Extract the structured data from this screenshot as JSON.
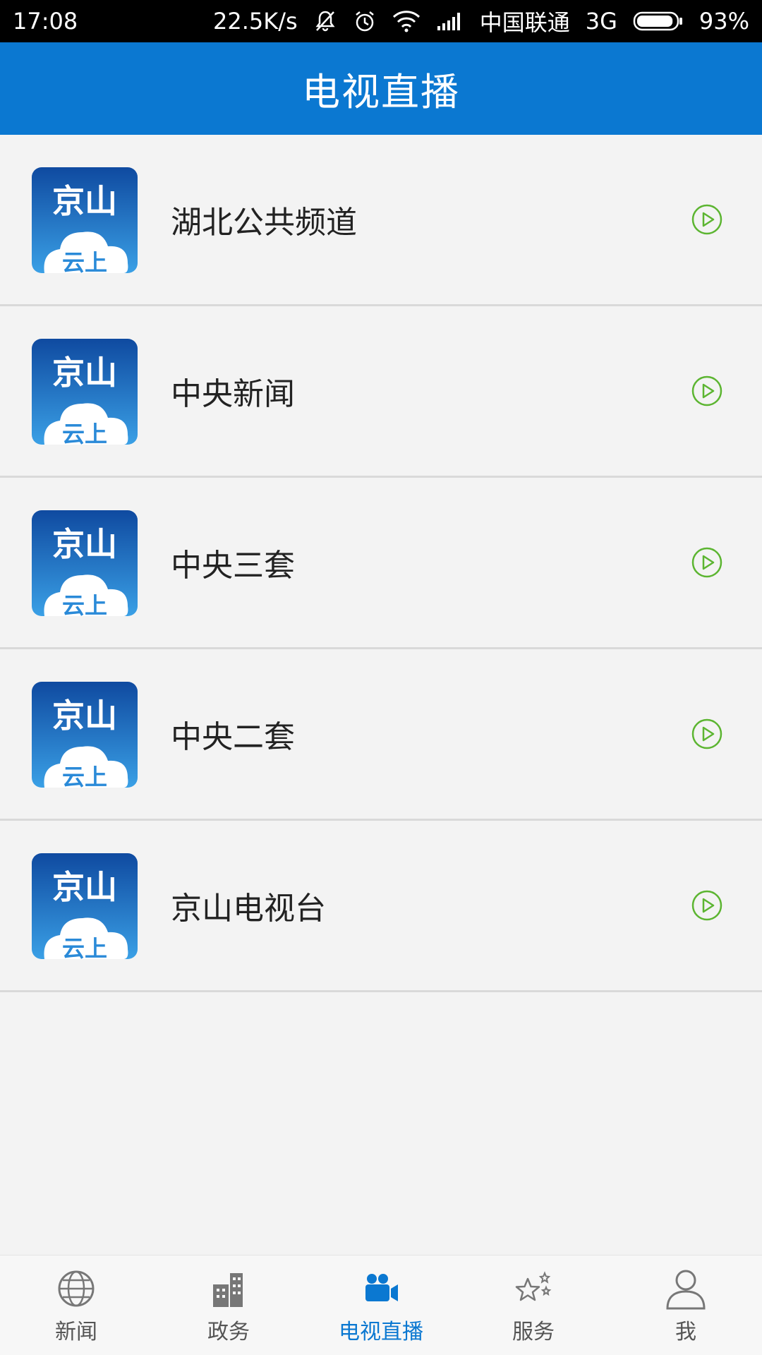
{
  "status": {
    "time": "17:08",
    "net_speed": "22.5K/s",
    "carrier": "中国联通",
    "network": "3G",
    "battery": "93%",
    "battery_level": 0.93
  },
  "header": {
    "title": "电视直播"
  },
  "channels": [
    {
      "name": "湖北公共频道",
      "logo_top": "京山",
      "logo_bottom": "云上"
    },
    {
      "name": "中央新闻",
      "logo_top": "京山",
      "logo_bottom": "云上"
    },
    {
      "name": "中央三套",
      "logo_top": "京山",
      "logo_bottom": "云上"
    },
    {
      "name": "中央二套",
      "logo_top": "京山",
      "logo_bottom": "云上"
    },
    {
      "name": "京山电视台",
      "logo_top": "京山",
      "logo_bottom": "云上"
    }
  ],
  "nav": {
    "items": [
      {
        "label": "新闻",
        "icon": "globe-icon"
      },
      {
        "label": "政务",
        "icon": "building-icon"
      },
      {
        "label": "电视直播",
        "icon": "video-camera-icon",
        "active": true
      },
      {
        "label": "服务",
        "icon": "stars-icon"
      },
      {
        "label": "我",
        "icon": "person-icon"
      }
    ]
  },
  "colors": {
    "accent": "#0b78d1",
    "play_green": "#5cb531",
    "logo_dark": "#0f4aa0",
    "logo_light": "#3aa0e6"
  }
}
